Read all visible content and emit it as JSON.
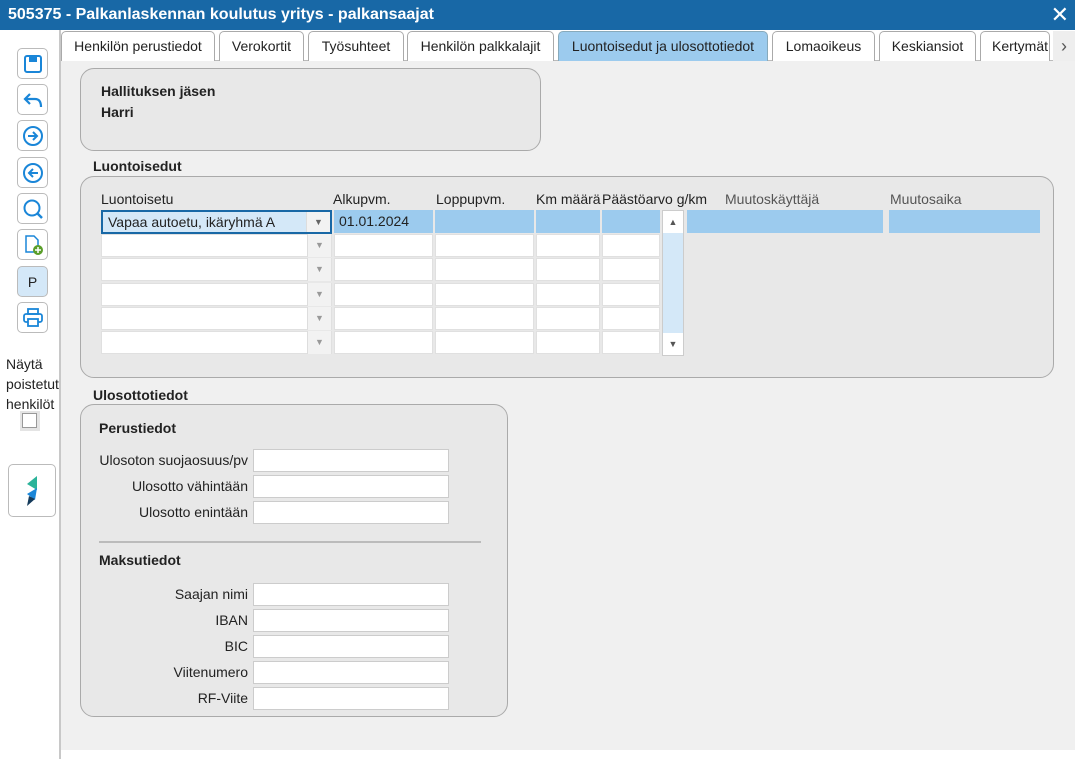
{
  "window": {
    "title": "505375 - Palkanlaskennan koulutus yritys - palkansaajat",
    "close": "✕"
  },
  "toolbar": {
    "print_p": "P",
    "show_deleted": "Näytä poistetut henkilöt"
  },
  "tabs": [
    "Henkilön perustiedot",
    "Verokortit",
    "Työsuhteet",
    "Henkilön palkkalajit",
    "Luontoisedut ja ulosottotiedot",
    "Lomaoikeus",
    "Keskiansiot",
    "Kertymät"
  ],
  "person": {
    "role": "Hallituksen jäsen",
    "name": "Harri"
  },
  "benefits": {
    "section": "Luontoisedut",
    "columns": [
      "Luontoisetu",
      "Alkupvm.",
      "Loppupvm.",
      "Km määrä",
      "Päästöarvo g/km",
      "Muutoskäyttäjä",
      "Muutosaika"
    ],
    "rows": [
      {
        "benefit": "Vapaa autoetu, ikäryhmä A",
        "start": "01.01.2024"
      }
    ]
  },
  "garnish": {
    "section": "Ulosottotiedot",
    "basic": "Perustiedot",
    "basic_fields": [
      "Ulosoton suojaosuus/pv",
      "Ulosotto vähintään",
      "Ulosotto enintään"
    ],
    "payment": "Maksutiedot",
    "payment_fields": [
      "Saajan nimi",
      "IBAN",
      "BIC",
      "Viitenumero",
      "RF-Viite"
    ]
  }
}
